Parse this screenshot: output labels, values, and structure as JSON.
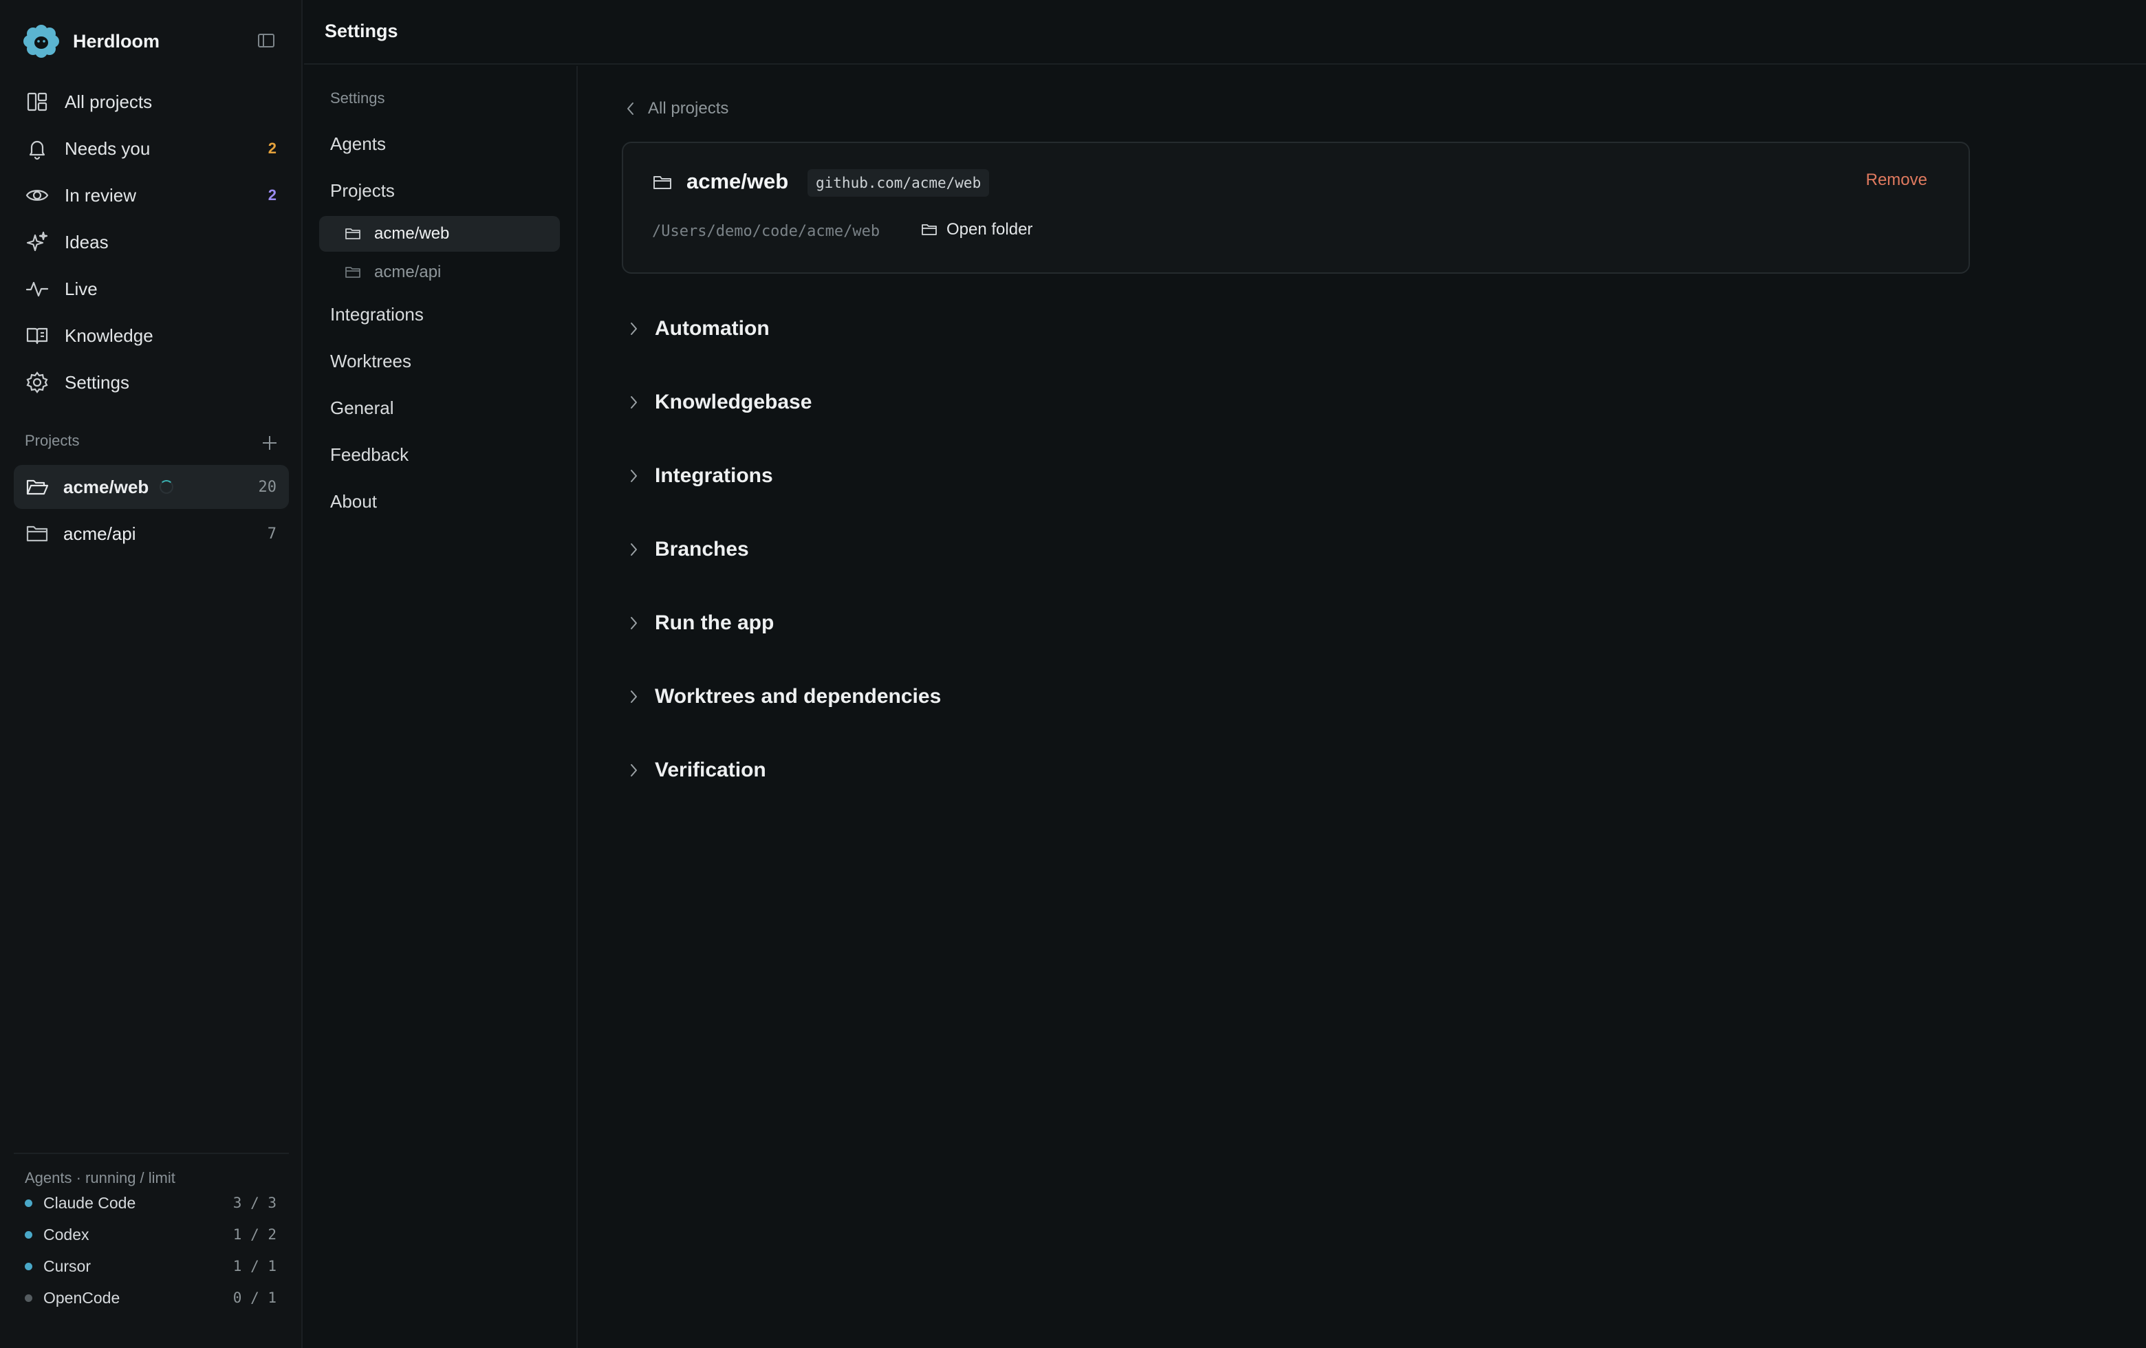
{
  "app": {
    "name": "Herdloom"
  },
  "nav": [
    {
      "label": "All projects",
      "icon": "grid-icon"
    },
    {
      "label": "Needs you",
      "icon": "bell-icon",
      "badge": "2",
      "badge_color": "#e6a23c"
    },
    {
      "label": "In review",
      "icon": "eye-icon",
      "badge": "2",
      "badge_color": "#9b8cf2"
    },
    {
      "label": "Ideas",
      "icon": "sparkle-icon"
    },
    {
      "label": "Live",
      "icon": "activity-icon"
    },
    {
      "label": "Knowledge",
      "icon": "book-icon"
    },
    {
      "label": "Settings",
      "icon": "gear-icon"
    }
  ],
  "projects": {
    "label": "Projects",
    "items": [
      {
        "name": "acme/web",
        "count": "20",
        "active": true,
        "loading": true
      },
      {
        "name": "acme/api",
        "count": "7",
        "active": false
      }
    ]
  },
  "agents": {
    "title": "Agents · running / limit",
    "items": [
      {
        "name": "Claude Code",
        "usage": "3 / 3",
        "color": "#4aa8c8"
      },
      {
        "name": "Codex",
        "usage": "1 / 2",
        "color": "#4aa8c8"
      },
      {
        "name": "Cursor",
        "usage": "1 / 1",
        "color": "#4aa8c8"
      },
      {
        "name": "OpenCode",
        "usage": "0 / 1",
        "color": "#555c60"
      }
    ]
  },
  "header": {
    "title": "Settings"
  },
  "settings_nav": {
    "section_label": "Settings",
    "items": [
      "Agents",
      "Projects",
      "Integrations",
      "Worktrees",
      "General",
      "Feedback",
      "About"
    ],
    "project_subitems": [
      "acme/web",
      "acme/api"
    ]
  },
  "main": {
    "back_label": "All projects",
    "project": {
      "name": "acme/web",
      "repo": "github.com/acme/web",
      "path": "/Users/demo/code/acme/web",
      "open_folder_label": "Open folder",
      "remove_label": "Remove"
    },
    "sections": [
      "Automation",
      "Knowledgebase",
      "Integrations",
      "Branches",
      "Run the app",
      "Worktrees and dependencies",
      "Verification"
    ]
  }
}
